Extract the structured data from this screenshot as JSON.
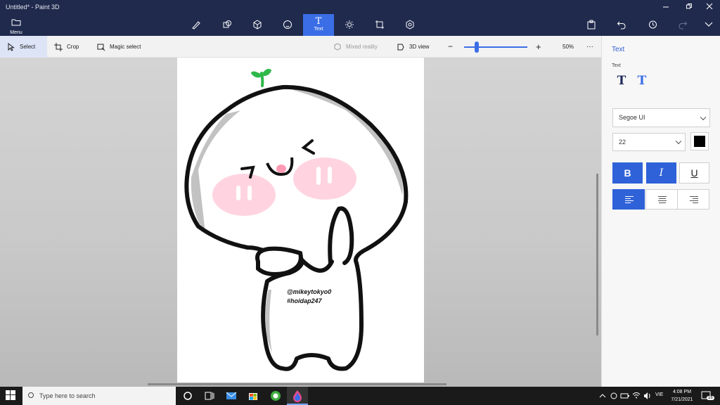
{
  "window": {
    "title": "Untitled* - Paint 3D"
  },
  "toolbar": {
    "menu_label": "Menu",
    "active_tool_label": "Text",
    "active_tool_glyph": "T",
    "tools": [
      "brushes-icon",
      "2d-shapes-icon",
      "3d-shapes-icon",
      "stickers-icon",
      "text-icon",
      "effects-icon",
      "canvas-icon",
      "3d-library-icon"
    ]
  },
  "subbar": {
    "select_label": "Select",
    "crop_label": "Crop",
    "magic_select_label": "Magic select",
    "mixed_reality_label": "Mixed reality",
    "view_3d_label": "3D view",
    "zoom_minus": "−",
    "zoom_plus": "+",
    "zoom_level": "50%",
    "zoom_fraction": 0.2,
    "more": "···"
  },
  "canvas": {
    "watermark_line1": "@mikeytokyo0",
    "watermark_line2": "#hoidap247"
  },
  "panel": {
    "title": "Text",
    "section": "Text",
    "font_family": "Segoe UI",
    "font_size": "22",
    "color": "#000000",
    "bold": "B",
    "italic": "I",
    "underline": "U"
  },
  "taskbar": {
    "search_placeholder": "Type here to search",
    "lang": "VIE",
    "time": "4:08 PM",
    "date": "7/21/2021",
    "notif_count": "16"
  },
  "colors": {
    "accent": "#3b6ee6",
    "titlebar": "#1f2a4d"
  }
}
